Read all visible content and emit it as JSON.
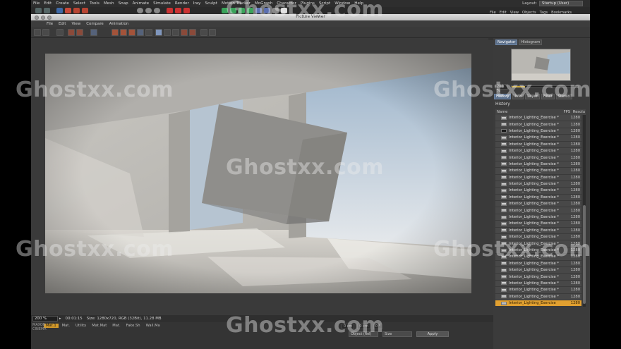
{
  "menu": [
    "File",
    "Edit",
    "Create",
    "Select",
    "Tools",
    "Mesh",
    "Snap",
    "Animate",
    "Simulate",
    "Render",
    "Iray",
    "Sculpt",
    "Motion Tracker",
    "MoGraph",
    "Character",
    "Plugins",
    "Script",
    "Window",
    "Help"
  ],
  "layout": {
    "label": "Layout:",
    "value": "Startup (User)"
  },
  "right_menu": [
    "File",
    "Edit",
    "View",
    "Objects",
    "Tags",
    "Bookmarks"
  ],
  "picture_viewer": {
    "title": "Picture Viewer",
    "menu": [
      "File",
      "Edit",
      "View",
      "Compare",
      "Animation"
    ]
  },
  "navigator": {
    "tabs": [
      "Navigator",
      "Histogram"
    ],
    "zoom": "200 %",
    "zoom_fraction": 0.2
  },
  "panel_tabs": [
    "History",
    "Info",
    "Layer",
    "Filter",
    "Stereo"
  ],
  "history": {
    "title": "History",
    "columns": [
      "Name",
      "FPS",
      "Resolu"
    ],
    "rows": [
      {
        "name": "Interior_Lighting_Exercise *",
        "res": "1280",
        "dark": false
      },
      {
        "name": "Interior_Lighting_Exercise *",
        "res": "1280",
        "dark": false
      },
      {
        "name": "Interior_Lighting_Exercise *",
        "res": "1280",
        "dark": true
      },
      {
        "name": "Interior_Lighting_Exercise *",
        "res": "1280",
        "dark": false
      },
      {
        "name": "Interior_Lighting_Exercise *",
        "res": "1280",
        "dark": false
      },
      {
        "name": "Interior_Lighting_Exercise *",
        "res": "1280",
        "dark": false
      },
      {
        "name": "Interior_Lighting_Exercise *",
        "res": "1280",
        "dark": false
      },
      {
        "name": "Interior_Lighting_Exercise *",
        "res": "1280",
        "dark": false
      },
      {
        "name": "Interior_Lighting_Exercise *",
        "res": "1280",
        "dark": false
      },
      {
        "name": "Interior_Lighting_Exercise *",
        "res": "1280",
        "dark": false
      },
      {
        "name": "Interior_Lighting_Exercise *",
        "res": "1280",
        "dark": false
      },
      {
        "name": "Interior_Lighting_Exercise *",
        "res": "1280",
        "dark": false
      },
      {
        "name": "Interior_Lighting_Exercise *",
        "res": "1280",
        "dark": false
      },
      {
        "name": "Interior_Lighting_Exercise *",
        "res": "1280",
        "dark": false
      },
      {
        "name": "Interior_Lighting_Exercise *",
        "res": "1280",
        "dark": false
      },
      {
        "name": "Interior_Lighting_Exercise *",
        "res": "1280",
        "dark": false
      },
      {
        "name": "Interior_Lighting_Exercise *",
        "res": "1280",
        "dark": false
      },
      {
        "name": "Interior_Lighting_Exercise *",
        "res": "1280",
        "dark": false
      },
      {
        "name": "Interior_Lighting_Exercise *",
        "res": "1280",
        "dark": false
      },
      {
        "name": "Interior_Lighting_Exercise *",
        "res": "1280",
        "dark": false
      },
      {
        "name": "Interior_Lighting_Exercise *",
        "res": "1280",
        "dark": false
      },
      {
        "name": "Interior_Lighting_Exercise *",
        "res": "1280",
        "dark": false
      },
      {
        "name": "Interior_Lighting_Exercise *",
        "res": "1280",
        "dark": false
      },
      {
        "name": "Interior_Lighting_Exercise *",
        "res": "1280",
        "dark": false
      },
      {
        "name": "Interior_Lighting_Exercise *",
        "res": "1280",
        "dark": false
      },
      {
        "name": "Interior_Lighting_Exercise *",
        "res": "1280",
        "dark": false
      },
      {
        "name": "Interior_Lighting_Exercise *",
        "res": "1280",
        "dark": false
      },
      {
        "name": "Interior_Lighting_Exercise *",
        "res": "1280",
        "dark": false
      },
      {
        "name": "Interior_Lighting_Exercise",
        "res": "1280",
        "dark": false,
        "selected": true
      }
    ]
  },
  "status": {
    "zoom": "200 %",
    "time": "00:01:15",
    "size": "Size: 1280x720, RGB (32Bit), 11.28 MB"
  },
  "material_tabs": [
    "Mat.1",
    "Mat.",
    "Utility",
    "Mat.Mat",
    "Mat.",
    "Fake.Sh",
    "Wall.Ma"
  ],
  "side_logo": "MAXON CINEMA",
  "coords": [
    "0 cm",
    "0 cm",
    "0 °"
  ],
  "attributes": {
    "mode": "Object (Rel)",
    "size": "Size",
    "apply": "Apply"
  },
  "watermark": "Ghostxx.com",
  "colors": {
    "accent": "#e1a030",
    "active_tab": "#5b6f8a"
  }
}
